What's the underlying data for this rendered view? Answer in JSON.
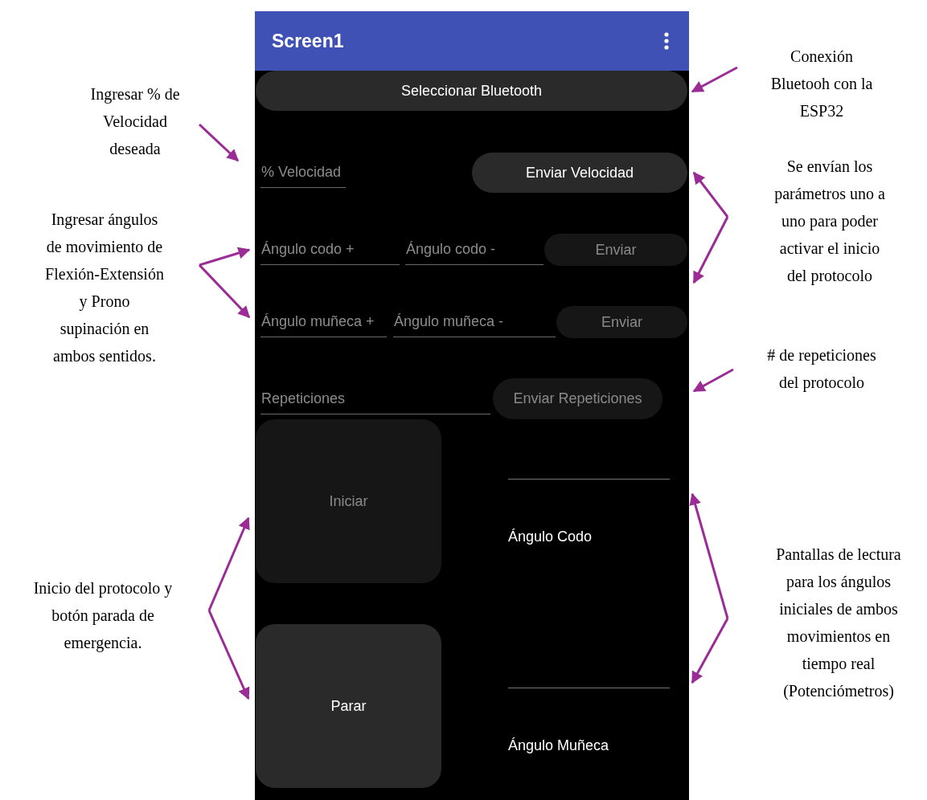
{
  "app_bar": {
    "title": "Screen1"
  },
  "bluetooth_button": {
    "label": "Seleccionar Bluetooth",
    "disabled": false
  },
  "rows": [
    {
      "fields": [
        {
          "placeholder": "% Velocidad"
        }
      ],
      "button": {
        "label": "Enviar Velocidad",
        "disabled": false
      }
    },
    {
      "fields": [
        {
          "placeholder": "Ángulo codo +"
        },
        {
          "placeholder": "Ángulo codo -"
        }
      ],
      "button": {
        "label": "Enviar",
        "disabled": true
      }
    },
    {
      "fields": [
        {
          "placeholder": "Ángulo muñeca +"
        },
        {
          "placeholder": "Ángulo muñeca -"
        }
      ],
      "button": {
        "label": "Enviar",
        "disabled": true
      }
    },
    {
      "fields": [
        {
          "placeholder": "Repeticiones"
        }
      ],
      "button": {
        "label": "Enviar Repeticiones",
        "disabled": true
      }
    }
  ],
  "control_buttons": [
    {
      "label": "Iniciar",
      "disabled": true
    },
    {
      "label": "Parar",
      "disabled": false
    }
  ],
  "readouts": [
    {
      "label": "Ángulo Codo"
    },
    {
      "label": "Ángulo Muñeca"
    }
  ],
  "left_notes": [
    {
      "lines": [
        "Ingresar % de",
        "Velocidad",
        "deseada"
      ]
    },
    {
      "lines": [
        "Ingresar ángulos",
        "de movimiento de",
        "Flexión-Extensión",
        "y Prono",
        "supinación en",
        "ambos sentidos."
      ]
    },
    {
      "lines": [
        "Inicio del protocolo y",
        "botón parada de",
        "emergencia."
      ]
    }
  ],
  "right_notes": [
    {
      "lines": [
        "Conexión",
        "Bluetooh con la",
        "ESP32"
      ]
    },
    {
      "lines": [
        "Se envían los",
        "parámetros uno a",
        "uno para poder",
        "activar el inicio",
        "del protocolo"
      ]
    },
    {
      "lines": [
        "# de repeticiones",
        "del protocolo"
      ]
    },
    {
      "lines": [
        "Pantallas de lectura",
        "para los ángulos",
        "iniciales de ambos",
        "movimientos en",
        "tiempo real",
        "(Potenciómetros)"
      ]
    }
  ]
}
